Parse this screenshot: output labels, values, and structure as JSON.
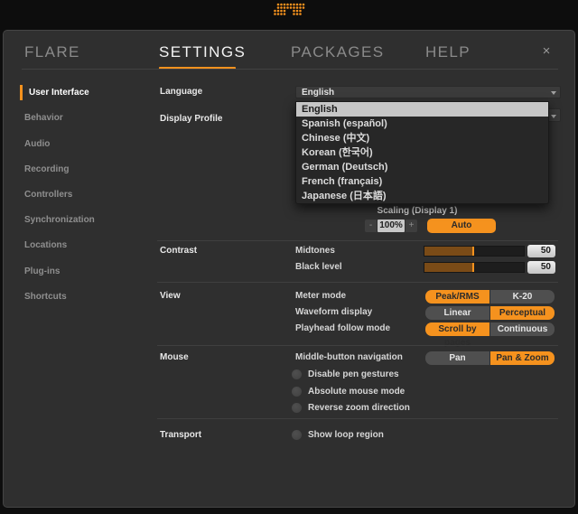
{
  "theme": {
    "accent": "#f5921e",
    "dialog_bg": "#2f2f2f",
    "topbar_bg": "#0d0d0d"
  },
  "topbar": {
    "logo": "dot-matrix-logo"
  },
  "tabs": {
    "flare": "FLARE",
    "settings": "SETTINGS",
    "packages": "PACKAGES",
    "help": "HELP",
    "close": "×"
  },
  "sidebar": {
    "items": [
      {
        "label": "User Interface",
        "active": true
      },
      {
        "label": "Behavior"
      },
      {
        "label": "Audio"
      },
      {
        "label": "Recording"
      },
      {
        "label": "Controllers"
      },
      {
        "label": "Synchronization"
      },
      {
        "label": "Locations"
      },
      {
        "label": "Plug-ins"
      },
      {
        "label": "Shortcuts"
      }
    ]
  },
  "language": {
    "label": "Language",
    "value": "English",
    "dropdown": {
      "options": [
        "English",
        "Spanish (español)",
        "Chinese (中文)",
        "Korean (한국어)",
        "German (Deutsch)",
        "French (français)",
        "Japanese (日本語)"
      ],
      "selected_index": 0
    }
  },
  "display": {
    "label": "Display Profile",
    "scaling_label": "Scaling (Display 1)",
    "zoom_out": "-",
    "zoom_value": "100%",
    "zoom_in": "+",
    "auto_button": "Auto"
  },
  "contrast": {
    "label": "Contrast",
    "midtones": {
      "label": "Midtones",
      "value": "50",
      "fill_pct": 50
    },
    "black_level": {
      "label": "Black level",
      "value": "50",
      "fill_pct": 50
    }
  },
  "view": {
    "label": "View",
    "meter_mode": {
      "label": "Meter mode",
      "left": "Peak/RMS",
      "right": "K-20",
      "selected": "left"
    },
    "waveform": {
      "label": "Waveform display",
      "left": "Linear",
      "right": "Perceptual",
      "selected": "right"
    },
    "playhead": {
      "label": "Playhead follow mode",
      "left": "Scroll by pages",
      "right": "Continuous",
      "selected": "left"
    }
  },
  "mouse": {
    "label": "Mouse",
    "middle_button": {
      "label": "Middle-button navigation",
      "left": "Pan",
      "right": "Pan & Zoom",
      "selected": "right"
    },
    "toggles": [
      {
        "label": "Disable pen gestures",
        "on": false
      },
      {
        "label": "Absolute mouse mode",
        "on": false
      },
      {
        "label": "Reverse zoom direction",
        "on": false
      }
    ]
  },
  "transport": {
    "label": "Transport",
    "toggles": [
      {
        "label": "Show loop region",
        "on": false
      }
    ]
  }
}
